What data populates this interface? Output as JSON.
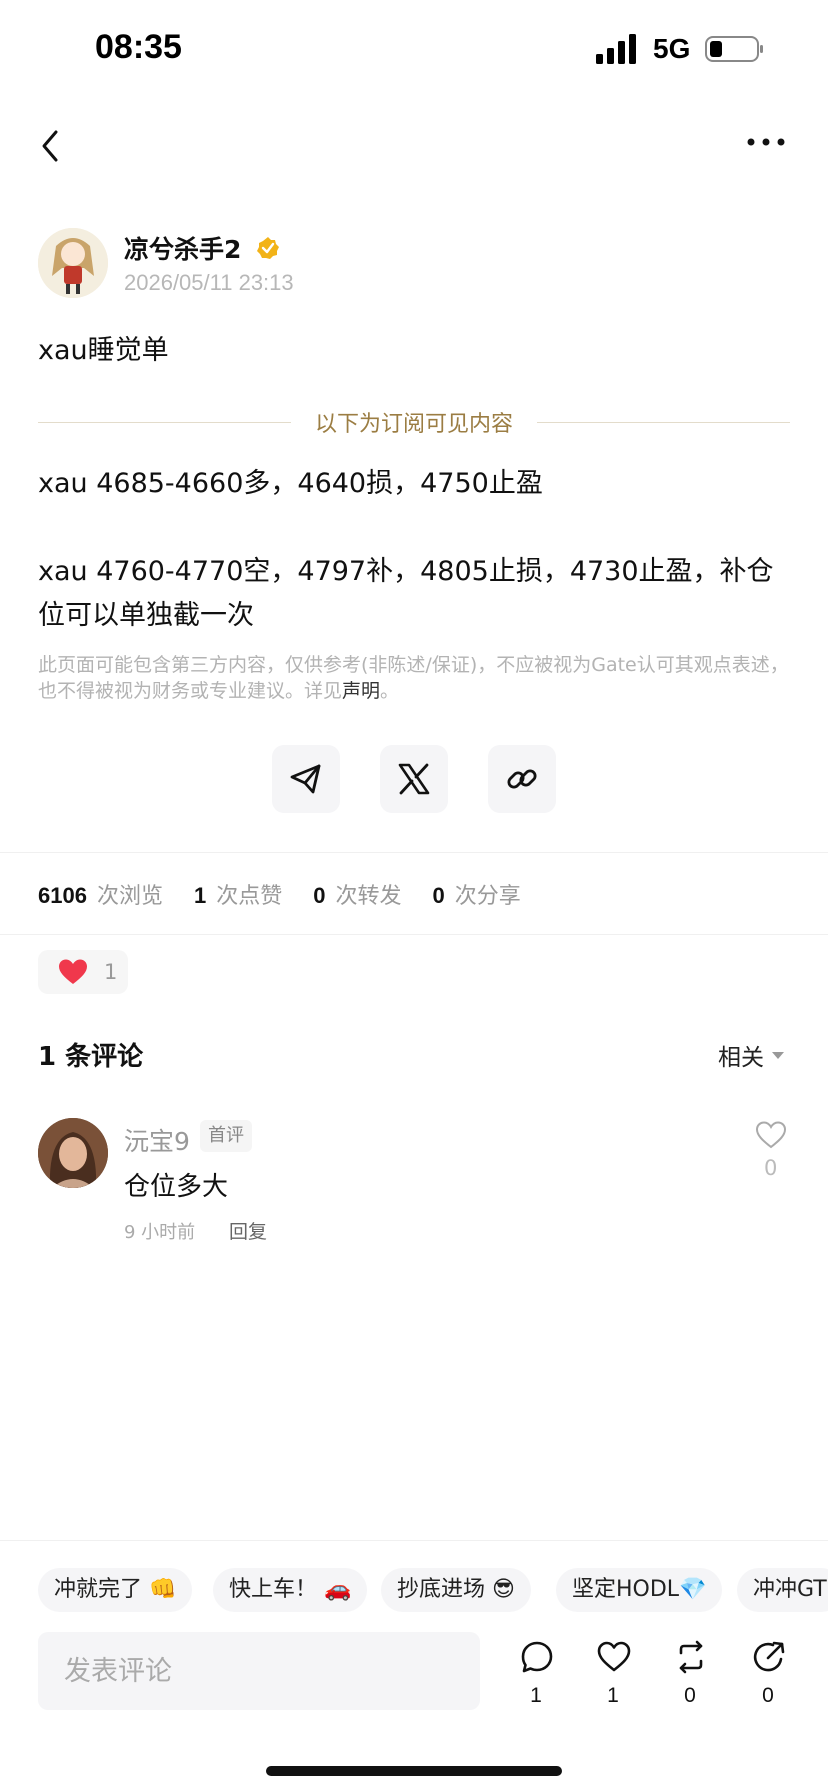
{
  "status_bar": {
    "time": "08:35",
    "network": "5G"
  },
  "post": {
    "author": "凉兮杀手2",
    "datetime": "2026/05/11 23:13",
    "title": "xau睡觉单",
    "subscriber_divider": "以下为订阅可见内容",
    "lines": [
      "xau 4685-4660多，4640损，4750止盈",
      "xau 4760-4770空，4797补，4805止损，4730止盈，补仓位可以单独截一次"
    ],
    "disclaimer": "此页面可能包含第三方内容，仅供参考(非陈述/保证)，不应被视为Gate认可其观点表述，也不得被视为财务或专业建议。详见",
    "disclaimer_link": "声明",
    "disclaimer_end": "。"
  },
  "share_icons": [
    "telegram-icon",
    "x-icon",
    "link-icon"
  ],
  "stats": {
    "views": "6106",
    "views_label": "次浏览",
    "likes": "1",
    "likes_label": "次点赞",
    "reposts": "0",
    "reposts_label": "次转发",
    "shares": "0",
    "shares_label": "次分享"
  },
  "reaction": {
    "icon": "heart-icon",
    "count": "1",
    "color": "#f0384c"
  },
  "comments": {
    "title": "1 条评论",
    "sort": "相关",
    "items": [
      {
        "name": "沅宝9",
        "badge": "首评",
        "text": "仓位多大",
        "time": "9 小时前",
        "reply": "回复",
        "likes": "0"
      }
    ]
  },
  "quick_replies": [
    "冲就完了 👊",
    "快上车！ 🚗",
    "抄底进场 😎",
    "坚定HODL💎",
    "冲冲GT"
  ],
  "composer": {
    "placeholder": "发表评论"
  },
  "actions": {
    "comments": "1",
    "likes": "1",
    "reposts": "0",
    "shares": "0"
  },
  "colors": {
    "accent_gold": "#9b7d43",
    "verified": "#f2b318",
    "heart": "#f0384c"
  }
}
